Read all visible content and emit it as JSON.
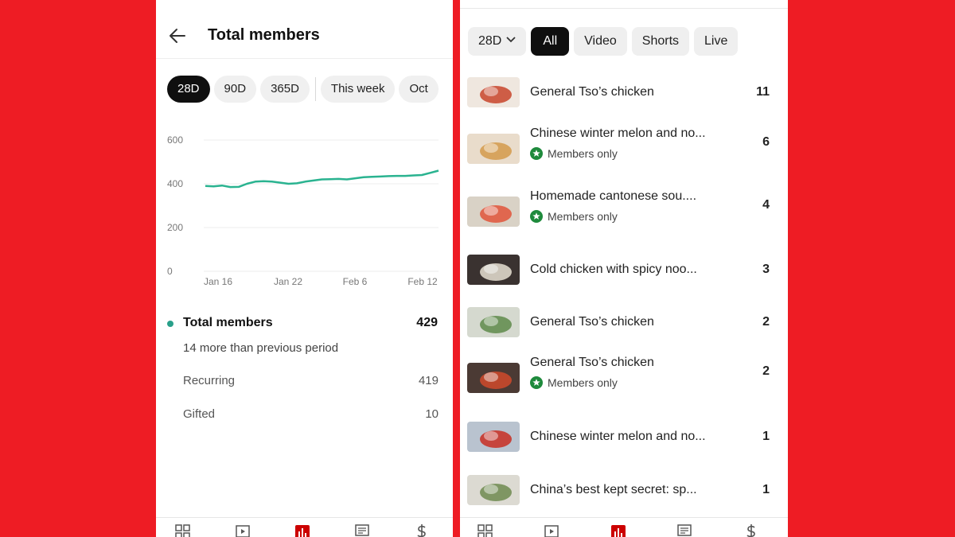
{
  "left": {
    "title": "Total members",
    "chips": [
      "28D",
      "90D",
      "365D",
      "This week",
      "Oct"
    ],
    "active_chip_index": 0,
    "chart_data": {
      "type": "line",
      "x": [
        "Jan 16",
        "Jan 22",
        "Feb 6",
        "Feb 12"
      ],
      "y_ticks": [
        "600",
        "400",
        "200",
        "0"
      ],
      "ylim": [
        0,
        600
      ],
      "series": [
        {
          "color": "#2ab390",
          "values": [
            390,
            388,
            392,
            385,
            386,
            400,
            410,
            412,
            410,
            405,
            400,
            402,
            410,
            415,
            420,
            421,
            422,
            420,
            425,
            430,
            432,
            433,
            435,
            436,
            436,
            438,
            440,
            450,
            460
          ]
        }
      ],
      "grid": true
    },
    "stats": {
      "main_label": "Total members",
      "main_value": "429",
      "sub_text": "14 more than previous period",
      "rows": [
        {
          "label": "Recurring",
          "value": "419"
        },
        {
          "label": "Gifted",
          "value": "10"
        }
      ]
    },
    "nav_icons": [
      "dashboard-icon",
      "content-icon",
      "analytics-icon",
      "comments-icon",
      "earn-icon"
    ]
  },
  "right": {
    "filters": {
      "period": "28D",
      "chips": [
        "All",
        "Video",
        "Shorts",
        "Live"
      ],
      "active_index": 0
    },
    "videos": [
      {
        "title": "General Tso’s chicken",
        "badge": "",
        "count": "11"
      },
      {
        "title": "Chinese winter melon and no...",
        "badge": "Members only",
        "count": "6"
      },
      {
        "title": "Homemade cantonese sou....",
        "badge": "Members only",
        "count": "4"
      },
      {
        "title": "Cold chicken with spicy noo...",
        "badge": "",
        "count": "3"
      },
      {
        "title": "General Tso’s chicken",
        "badge": "",
        "count": "2"
      },
      {
        "title": "General Tso’s chicken",
        "badge": "Members only",
        "count": "2"
      },
      {
        "title": "Chinese winter melon and no...",
        "badge": "",
        "count": "1"
      },
      {
        "title": "China’s best kept secret: sp...",
        "badge": "",
        "count": "1"
      }
    ],
    "nav_icons": [
      "dashboard-icon",
      "content-icon",
      "analytics-icon",
      "comments-icon",
      "earn-icon"
    ]
  },
  "colors": {
    "background": "#ee1c24",
    "accent_line": "#2ab390",
    "members_badge": "#1e8a3c",
    "active_nav": "#cc0000"
  }
}
